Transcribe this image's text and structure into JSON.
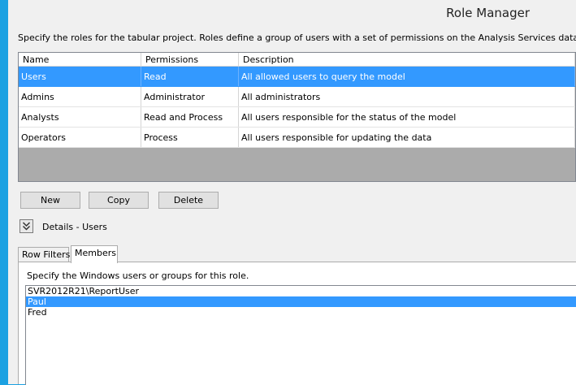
{
  "window": {
    "title": "Role Manager"
  },
  "instructions": "Specify the roles for the tabular project. Roles define a group of users with a set of permissions on the Analysis Services database.",
  "roles_grid": {
    "headers": {
      "name": "Name",
      "permissions": "Permissions",
      "description": "Description"
    },
    "rows": [
      {
        "name": "Users",
        "permissions": "Read",
        "description": "All allowed users to query the model"
      },
      {
        "name": "Admins",
        "permissions": "Administrator",
        "description": "All administrators"
      },
      {
        "name": "Analysts",
        "permissions": "Read and Process",
        "description": "All users responsible for the status of the model"
      },
      {
        "name": "Operators",
        "permissions": "Process",
        "description": "All users responsible for updating the data"
      }
    ],
    "selected_index": 0
  },
  "buttons": {
    "new": "New",
    "copy": "Copy",
    "delete": "Delete"
  },
  "details": {
    "label": "Details - Users",
    "toggle_icon": "double-chevron-down-icon"
  },
  "tabs": [
    {
      "label": "Row Filters",
      "active": false
    },
    {
      "label": "Members",
      "active": true
    }
  ],
  "members_tab": {
    "description": "Specify the Windows users or groups for this role.",
    "members": [
      "SVR2012R21\\ReportUser",
      "Paul",
      "Fred"
    ],
    "selected_index": 1
  },
  "colors": {
    "window_border": "#1ba1e2",
    "selection": "#3399ff",
    "background": "#f0f0f0"
  }
}
